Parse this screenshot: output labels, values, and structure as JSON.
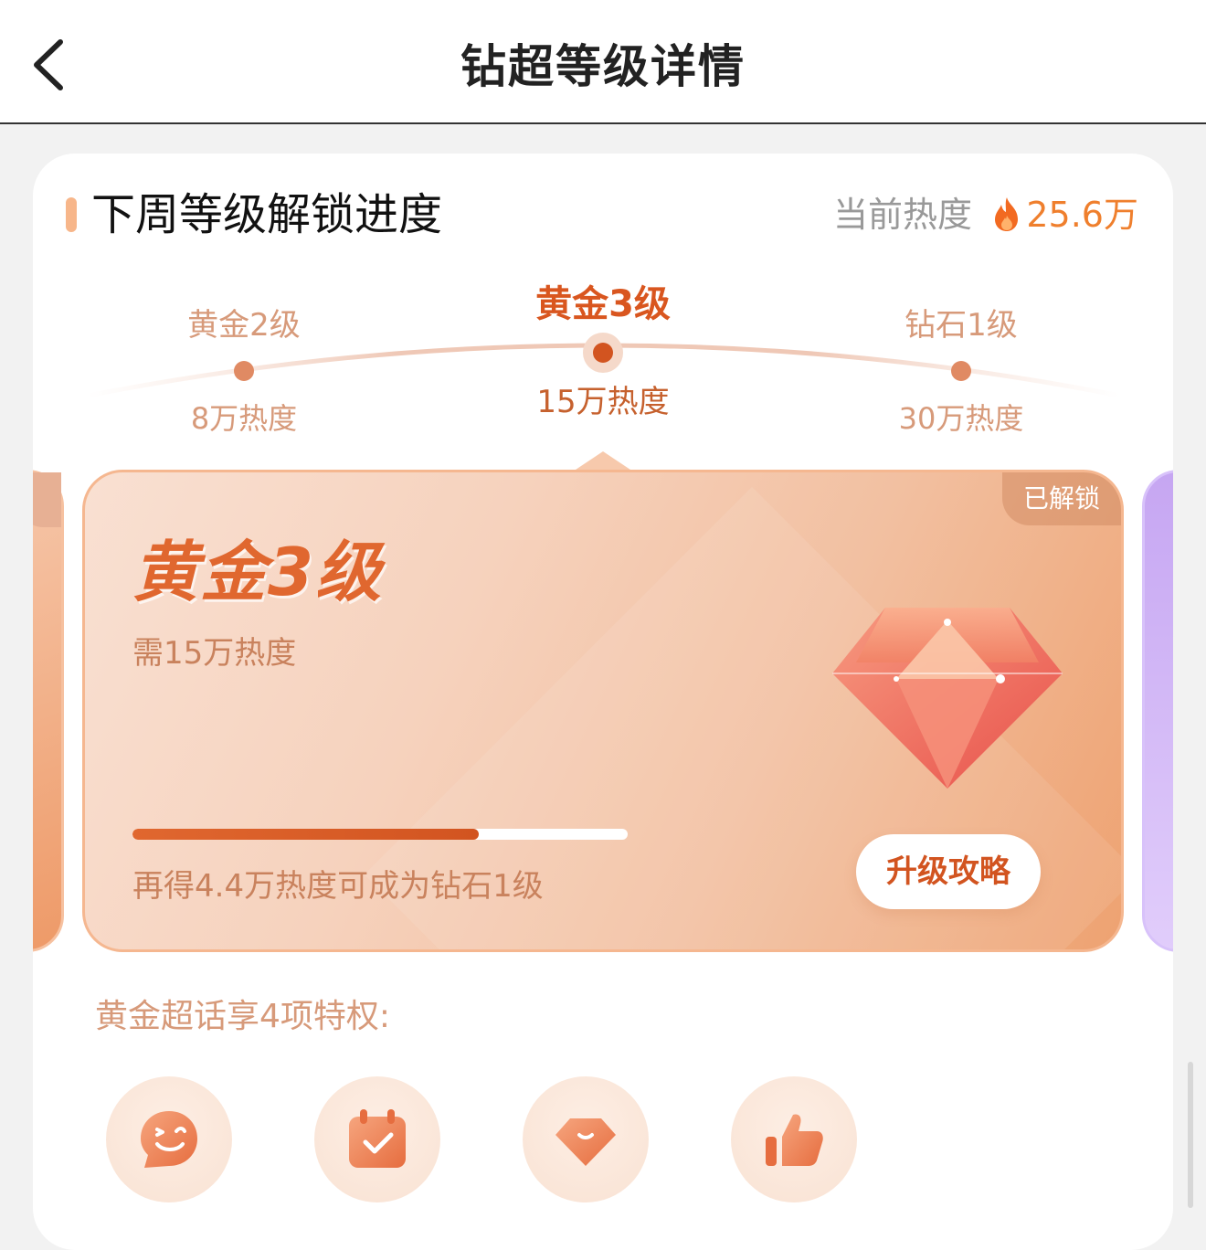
{
  "header": {
    "title": "钻超等级详情"
  },
  "section": {
    "title": "下周等级解锁进度",
    "heat_label": "当前热度",
    "heat_value": "25.6万"
  },
  "timeline": {
    "levels": [
      {
        "name": "黄金2级",
        "heat": "8万热度"
      },
      {
        "name": "黄金3级",
        "heat": "15万热度",
        "active": true
      },
      {
        "name": "钻石1级",
        "heat": "30万热度"
      }
    ]
  },
  "level_card": {
    "tag": "已解锁",
    "level_name": "黄金3级",
    "requirement": "需15万热度",
    "progress_fraction": 0.7,
    "remaining_text": "再得4.4万热度可成为钻石1级",
    "upgrade_button": "升级攻略"
  },
  "privileges": {
    "title": "黄金超话享4项特权:",
    "items": [
      {
        "icon": "smile-chat-icon"
      },
      {
        "icon": "calendar-check-icon"
      },
      {
        "icon": "diamond-icon"
      },
      {
        "icon": "thumbs-up-icon"
      }
    ]
  },
  "colors": {
    "accent": "#d9561f",
    "heat": "#ef7f2d",
    "muted_orange": "#d79a7a",
    "card_gradient_end": "#eea271"
  }
}
